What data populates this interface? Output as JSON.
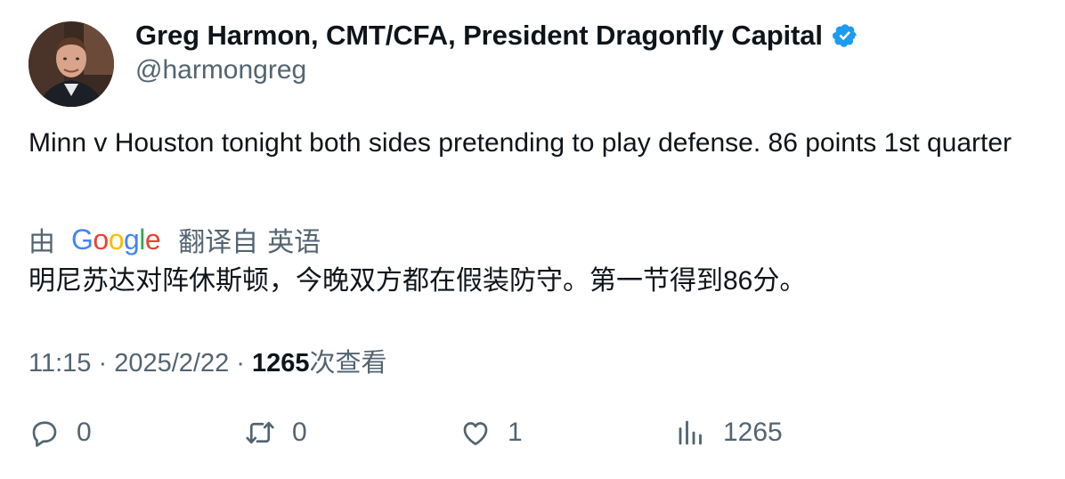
{
  "author": {
    "display_name": "Greg Harmon, CMT/CFA, President Dragonfly Capital",
    "handle": "@harmongreg",
    "verified": true,
    "verified_color": "#1d9bf0"
  },
  "tweet": {
    "text": "Minn v Houston tonight both sides pretending to play defense. 86 points 1st quarter"
  },
  "translation": {
    "by_label": "由",
    "provider": "Google",
    "translated_from_label": "翻译自",
    "source_language": "英语",
    "text": "明尼苏达对阵休斯顿，今晚双方都在假装防守。第一节得到86分。"
  },
  "meta": {
    "time": "11:15",
    "separator": "·",
    "date": "2025/2/22",
    "views_count": "1265",
    "views_label": "次查看"
  },
  "actions": {
    "replies": "0",
    "retweets": "0",
    "likes": "1",
    "views": "1265",
    "icons": [
      "reply-icon",
      "retweet-icon",
      "like-icon",
      "views-icon"
    ]
  }
}
